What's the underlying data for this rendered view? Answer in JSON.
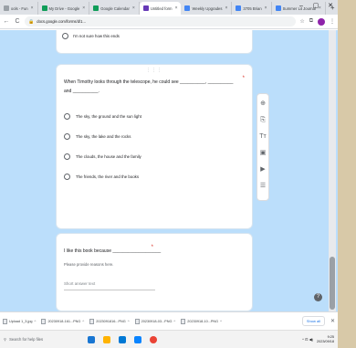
{
  "browser": {
    "tabs": [
      {
        "label": "ools - Fun",
        "color": "#9aa0a6"
      },
      {
        "label": "My Drive - Google",
        "color": "#0f9d58"
      },
      {
        "label": "Google Calendar",
        "color": "#0f9d58"
      },
      {
        "label": "Untitled form",
        "color": "#673ab7",
        "active": true
      },
      {
        "label": "Weekly Upgrades",
        "color": "#4285f4"
      },
      {
        "label": "3705 Brian",
        "color": "#4285f4"
      },
      {
        "label": "Summer Lit Journal",
        "color": "#4285f4"
      }
    ],
    "new_tab": "+",
    "window": {
      "minimize": "–",
      "maximize": "▢",
      "close": "✕"
    },
    "url": "docs.google.com/forms/d/1...",
    "nav": {
      "back": "←",
      "forward": "→",
      "reload": "C"
    }
  },
  "form": {
    "top_card_option": "I'm not sure how this ends",
    "question": {
      "text": "When Timothy looks through the telescope, he could see __________, __________ and __________.",
      "required_mark": "*",
      "drag_handle": "⋮⋮⋮",
      "options": [
        "The sky, the ground and the sun light",
        "The sky, the lake and the rocks",
        "The clouds, the house and the family",
        "The friends, the river and the books"
      ]
    },
    "question2": {
      "text": "I like this book because ___________________",
      "required_mark": "*",
      "helper": "Please provide reasons here.",
      "placeholder": "Short answer text"
    }
  },
  "floating_toolbar": {
    "icons": [
      {
        "name": "add-question-icon",
        "glyph": "⊕"
      },
      {
        "name": "import-questions-icon",
        "glyph": "⎘"
      },
      {
        "name": "add-title-icon",
        "glyph": "Tт"
      },
      {
        "name": "add-image-icon",
        "glyph": "▣"
      },
      {
        "name": "add-video-icon",
        "glyph": "▶"
      },
      {
        "name": "add-section-icon",
        "glyph": "☰"
      }
    ]
  },
  "downloads": {
    "items": [
      "Upload 1_3.jpg",
      "20230918-161...PNG",
      "2023091816...PNG",
      "20230918-03...PNG",
      "20230918-10...PNG"
    ],
    "show_all": "Show all"
  },
  "taskbar": {
    "search_text": "Search for help files",
    "time": "9:25",
    "date": "2023/09/18"
  }
}
